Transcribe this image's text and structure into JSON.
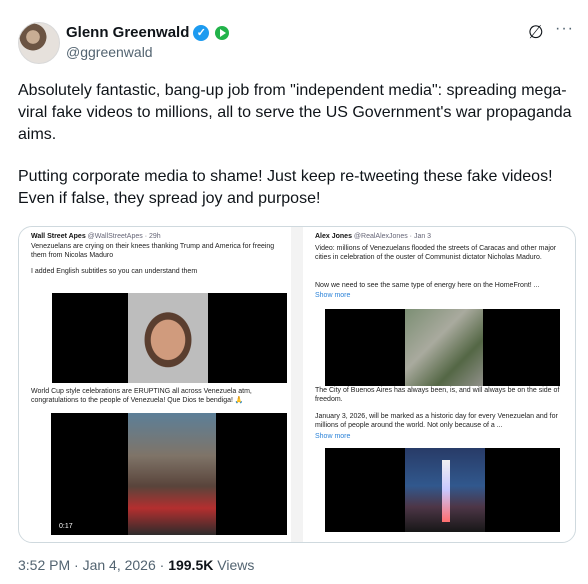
{
  "header": {
    "name": "Glenn Greenwald",
    "handle": "@ggreenwald",
    "verified_icon": "verified-badge-icon",
    "subscription_icon": "play-badge-icon",
    "grok_icon": "grok-icon",
    "more_icon": "more-icon",
    "grok_glyph": "∅",
    "more_glyph": "···",
    "verified_glyph": "✓"
  },
  "tweet": {
    "paragraph1": "Absolutely fantastic, bang-up job from \"independent media\": spreading mega-viral fake videos to millions, all to serve the US Government's war propaganda aims.",
    "paragraph2": "Putting corporate media to shame! Just keep re-tweeting these fake videos! Even if false, they spread joy and purpose!"
  },
  "media": {
    "left": {
      "account_name": "Wall Street Apes",
      "account_meta": "@WallStreetApes · 29h",
      "text1": "Venezuelans are crying on their knees thanking Trump and America for freeing them from Nicolas Maduro",
      "text2": "I added English subtitles so you can understand them",
      "text3": "World Cup style celebrations are ERUPTING all across Venezuela atm, congratulations to the people of Venezuela! Que Dios te bendiga! 🙏",
      "video_time": "0:17"
    },
    "right": {
      "account_name": "Alex Jones",
      "account_meta": "@RealAlexJones · Jan 3",
      "text1": "Video: millions of Venezuelans flooded the streets of Caracas and other major cities in celebration of the ouster of Communist dictator Nicholas Maduro.",
      "text2": "Now we need to see the same type of energy here on the HomeFront! ...",
      "show_more": "Show more",
      "text3": "The City of Buenos Aires has always been, is, and will always be on the side of freedom.",
      "text4": "January 3, 2026, will be marked as a historic day for every Venezuelan and for millions of people around the world. Not only because of a ...",
      "show_more2": "Show more"
    }
  },
  "footer": {
    "time": "3:52 PM · Jan 4, 2026 ·",
    "views_value": "199.5K",
    "views_label": "Views"
  }
}
